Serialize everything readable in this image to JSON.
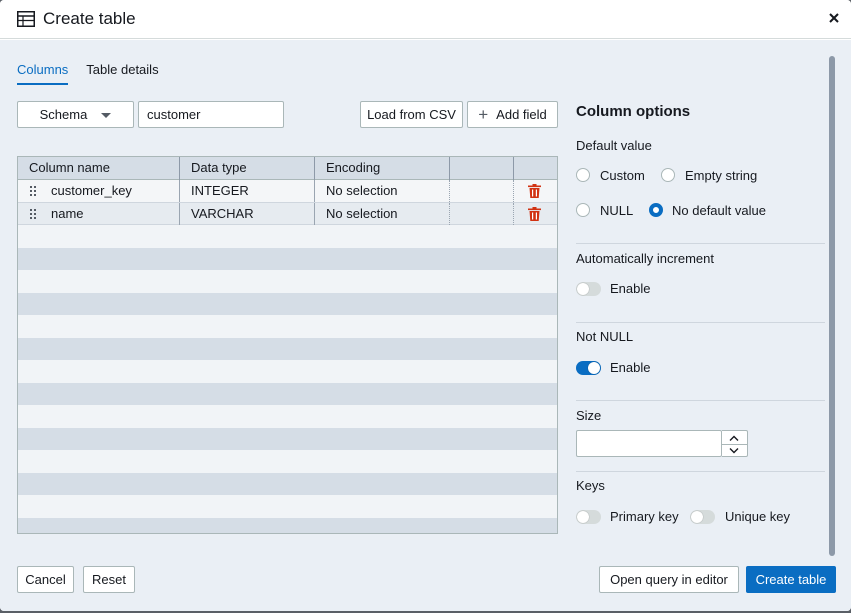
{
  "dialog": {
    "title": "Create table",
    "close_icon": "close-icon",
    "table_icon": "table-icon"
  },
  "tabs": [
    {
      "label": "Columns",
      "active": true
    },
    {
      "label": "Table details",
      "active": false
    }
  ],
  "toolbar": {
    "schema_label": "Schema",
    "table_name_value": "customer",
    "load_csv_label": "Load from CSV",
    "add_field_label": "Add field"
  },
  "grid": {
    "headers": [
      "Column name",
      "Data type",
      "Encoding"
    ],
    "rows": [
      {
        "name": "customer_key",
        "type": "INTEGER",
        "encoding": "No selection"
      },
      {
        "name": "name",
        "type": "VARCHAR",
        "encoding": "No selection"
      }
    ]
  },
  "column_options": {
    "title": "Column options",
    "default_value": {
      "label": "Default value",
      "options": [
        "Custom",
        "Empty string",
        "NULL",
        "No default value"
      ],
      "selected": "No default value"
    },
    "auto_increment": {
      "label": "Automatically increment",
      "toggle_label": "Enable",
      "on": false
    },
    "not_null": {
      "label": "Not NULL",
      "toggle_label": "Enable",
      "on": true
    },
    "size": {
      "label": "Size",
      "value": ""
    },
    "keys": {
      "label": "Keys",
      "primary_label": "Primary key",
      "primary_on": false,
      "unique_label": "Unique key",
      "unique_on": false
    }
  },
  "footer": {
    "cancel_label": "Cancel",
    "reset_label": "Reset",
    "open_query_label": "Open query in editor",
    "create_label": "Create table"
  },
  "colors": {
    "accent": "#0a6dc2",
    "delete": "#d13212",
    "panel_bg": "#eaeff5"
  }
}
